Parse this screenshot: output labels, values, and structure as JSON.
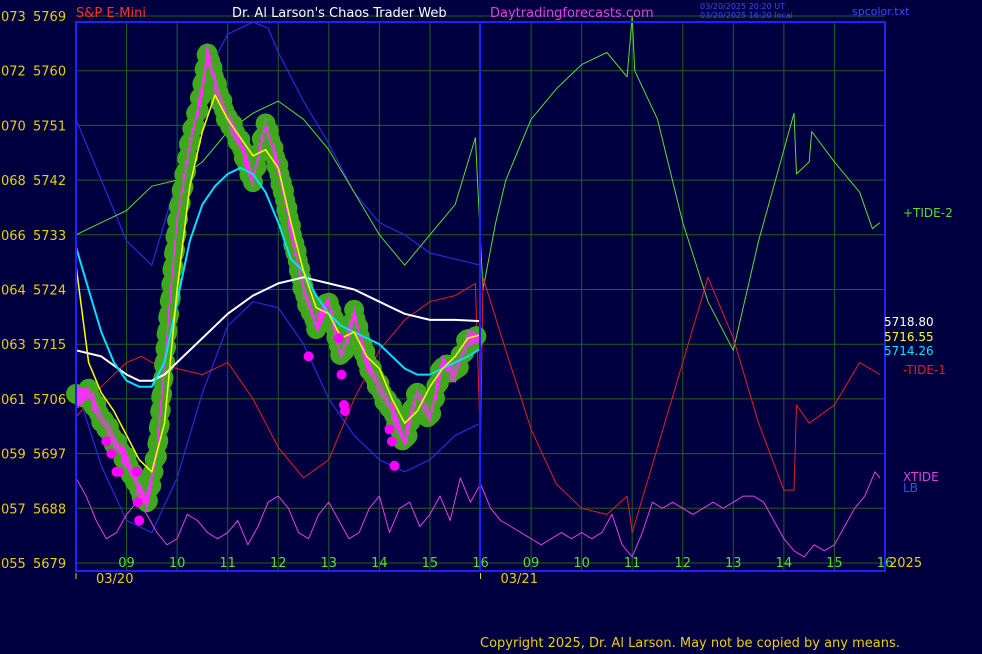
{
  "header": {
    "instrument": "S&P E-Mini",
    "site": "Dr. Al Larson's Chaos Trader Web",
    "url": "Daytradingforecasts.com",
    "stamp_line1": "03/20/2025 20:20 UT",
    "stamp_line2": "03/20/2025 16:20 local",
    "filename": "spcolor.txt"
  },
  "footer": {
    "copyright": "Copyright 2025, Dr. Al Larson. May not be copied by any means."
  },
  "colors": {
    "background": "#000040",
    "frame": "#2020ff",
    "grid": "#1f5f1f",
    "axis_text": "#e8d000",
    "price_bars": "#ff30ff",
    "price_halo": "#3fa81e",
    "ma_fast": "#ffff00",
    "ma_mid": "#00e0ff",
    "ma_slow": "#ffffff",
    "tide_plus": "#5fdc2a",
    "tide_minus": "#e02020",
    "xtide": "#e040e0",
    "envelope": "#2a2ad8",
    "marker": "#ff00ff"
  },
  "chart_data": {
    "type": "line",
    "title": "S&P E-Mini",
    "y_axis": {
      "label_pairs": [
        {
          "left": "073",
          "price": "5769"
        },
        {
          "left": "072",
          "price": "5760"
        },
        {
          "left": "070",
          "price": "5751"
        },
        {
          "left": "068",
          "price": "5742"
        },
        {
          "left": "066",
          "price": "5733"
        },
        {
          "left": "064",
          "price": "5724"
        },
        {
          "left": "063",
          "price": "5715"
        },
        {
          "left": "061",
          "price": "5706"
        },
        {
          "left": "059",
          "price": "5697"
        },
        {
          "left": "057",
          "price": "5688"
        },
        {
          "left": "055",
          "price": "5679"
        }
      ],
      "range": [
        5679,
        5769
      ]
    },
    "x_axis": {
      "hour_ticks": [
        "09",
        "10",
        "11",
        "12",
        "13",
        "14",
        "15",
        "16",
        "09",
        "10",
        "11",
        "12",
        "13",
        "14",
        "15",
        "16"
      ],
      "date_labels": [
        "03/20",
        "03/21"
      ],
      "year_label": "2025",
      "hour_range": [
        8,
        24
      ],
      "day_split_hour": 16
    },
    "readouts": {
      "ma_slow": "5718.80",
      "ma_fast": "5716.55",
      "ma_mid": "5714.26"
    },
    "series_labels": {
      "tide_plus": "+TIDE-2",
      "tide_minus": "-TIDE-1",
      "xtide": "XTIDE",
      "lb": "LB"
    },
    "price": {
      "t": [
        8.0,
        8.25,
        8.5,
        8.75,
        9.0,
        9.25,
        9.4,
        9.6,
        9.75,
        10.0,
        10.25,
        10.5,
        10.6,
        10.75,
        11.0,
        11.25,
        11.5,
        11.75,
        12.0,
        12.25,
        12.5,
        12.75,
        13.0,
        13.25,
        13.5,
        13.75,
        14.0,
        14.25,
        14.5,
        14.75,
        15.0,
        15.25,
        15.5,
        15.75,
        16.0
      ],
      "v": [
        5706,
        5707,
        5703,
        5699,
        5696,
        5691,
        5689,
        5697,
        5712,
        5735,
        5748,
        5757,
        5763,
        5758,
        5752,
        5748,
        5742,
        5751,
        5744,
        5734,
        5724,
        5718,
        5722,
        5713,
        5720,
        5712,
        5708,
        5704,
        5699,
        5707,
        5703,
        5712,
        5710,
        5716,
        5716
      ]
    },
    "ma_fast": {
      "t": [
        8.0,
        8.25,
        8.5,
        8.75,
        9.0,
        9.25,
        9.5,
        9.75,
        10.0,
        10.25,
        10.5,
        10.75,
        11.0,
        11.25,
        11.5,
        11.75,
        12.0,
        12.25,
        12.5,
        12.75,
        13.0,
        13.25,
        13.5,
        13.75,
        14.0,
        14.25,
        14.5,
        14.75,
        15.0,
        15.25,
        15.5,
        15.75,
        16.0
      ],
      "v": [
        5728,
        5712,
        5707,
        5704,
        5700,
        5696,
        5694,
        5702,
        5724,
        5741,
        5750,
        5756,
        5752,
        5749,
        5746,
        5747,
        5744,
        5735,
        5727,
        5721,
        5720,
        5716,
        5717,
        5713,
        5711,
        5706,
        5702,
        5704,
        5708,
        5711,
        5713,
        5716,
        5716.55
      ]
    },
    "ma_mid": {
      "t": [
        8.0,
        8.25,
        8.5,
        8.75,
        9.0,
        9.25,
        9.5,
        9.75,
        10.0,
        10.25,
        10.5,
        10.75,
        11.0,
        11.25,
        11.5,
        11.75,
        12.0,
        12.25,
        12.5,
        12.75,
        13.0,
        13.25,
        13.5,
        13.75,
        14.0,
        14.25,
        14.5,
        14.75,
        15.0,
        15.25,
        15.5,
        15.75,
        16.0
      ],
      "v": [
        5731,
        5724,
        5717,
        5712,
        5709,
        5708,
        5708,
        5712,
        5722,
        5732,
        5738,
        5741,
        5743,
        5744,
        5743,
        5740,
        5735,
        5729,
        5727,
        5723,
        5720,
        5718,
        5717,
        5716,
        5715,
        5713,
        5711,
        5710,
        5710,
        5711,
        5712,
        5713,
        5714.26
      ]
    },
    "ma_slow": {
      "t": [
        8.0,
        8.5,
        9.0,
        9.25,
        9.5,
        9.75,
        10.0,
        10.5,
        11.0,
        11.5,
        12.0,
        12.5,
        13.0,
        13.5,
        14.0,
        14.5,
        15.0,
        15.5,
        16.0
      ],
      "v": [
        5714,
        5713,
        5710,
        5709,
        5709,
        5710,
        5712,
        5716,
        5720,
        5723,
        5725,
        5726,
        5725,
        5724,
        5722,
        5720,
        5719,
        5719,
        5718.8
      ]
    },
    "tide_plus": {
      "t": [
        8.0,
        8.25,
        8.5,
        9.0,
        9.5,
        10.0,
        10.5,
        11.0,
        11.5,
        12.0,
        12.5,
        13.0,
        13.5,
        14.0,
        14.5,
        15.0,
        15.5,
        15.9,
        16.0,
        16.05,
        16.3,
        16.5,
        17.0,
        17.5,
        18.0,
        18.5,
        18.9,
        19.0,
        19.05,
        19.5,
        20.0,
        20.5,
        21.0,
        21.5,
        22.0,
        22.2,
        22.25,
        22.5,
        22.55,
        23.0,
        23.5,
        23.75,
        23.9
      ],
      "v": [
        5733,
        5734,
        5735,
        5737,
        5741,
        5742,
        5745,
        5750,
        5753,
        5755,
        5752,
        5747,
        5740,
        5733,
        5728,
        5733,
        5738,
        5749,
        5732,
        5724,
        5735,
        5742,
        5752,
        5757,
        5761,
        5763,
        5759,
        5769,
        5760,
        5752,
        5735,
        5722,
        5714,
        5732,
        5747,
        5753,
        5743,
        5745,
        5750,
        5745,
        5740,
        5734,
        5735
      ]
    },
    "tide_minus": {
      "t": [
        8.0,
        8.5,
        9.0,
        9.3,
        9.5,
        10.0,
        10.5,
        11.0,
        11.5,
        12.0,
        12.5,
        13.0,
        13.5,
        14.0,
        14.5,
        15.0,
        15.5,
        15.9,
        16.0,
        16.05,
        16.5,
        17.0,
        17.5,
        18.0,
        18.5,
        18.9,
        19.0,
        19.5,
        20.0,
        20.5,
        21.0,
        21.5,
        22.0,
        22.2,
        22.25,
        22.5,
        23.0,
        23.5,
        23.9
      ],
      "v": [
        5703,
        5708,
        5712,
        5713,
        5712,
        5711,
        5710,
        5712,
        5706,
        5698,
        5693,
        5696,
        5706,
        5714,
        5719,
        5722,
        5723,
        5725,
        5698,
        5726,
        5714,
        5701,
        5692,
        5688,
        5687,
        5690,
        5684,
        5698,
        5712,
        5726,
        5716,
        5702,
        5691,
        5691,
        5705,
        5702,
        5705,
        5712,
        5710
      ]
    },
    "xtide": {
      "t": [
        8.0,
        8.2,
        8.4,
        8.6,
        8.8,
        9.0,
        9.2,
        9.4,
        9.6,
        9.8,
        10.0,
        10.2,
        10.4,
        10.6,
        10.8,
        11.0,
        11.2,
        11.4,
        11.6,
        11.8,
        12.0,
        12.2,
        12.4,
        12.6,
        12.8,
        13.0,
        13.2,
        13.4,
        13.6,
        13.8,
        14.0,
        14.2,
        14.4,
        14.6,
        14.8,
        15.0,
        15.2,
        15.4,
        15.6,
        15.8,
        16.0,
        16.2,
        16.4,
        16.6,
        16.8,
        17.0,
        17.2,
        17.4,
        17.6,
        17.8,
        18.0,
        18.2,
        18.4,
        18.6,
        18.8,
        19.0,
        19.2,
        19.4,
        19.6,
        19.8,
        20.0,
        20.2,
        20.4,
        20.6,
        20.8,
        21.0,
        21.2,
        21.4,
        21.6,
        21.8,
        22.0,
        22.2,
        22.4,
        22.6,
        22.8,
        23.0,
        23.2,
        23.4,
        23.6,
        23.8,
        23.9
      ],
      "v": [
        5693,
        5690,
        5686,
        5683,
        5684,
        5687,
        5689,
        5687,
        5684,
        5682,
        5683,
        5687,
        5686,
        5684,
        5683,
        5684,
        5686,
        5682,
        5685,
        5689,
        5690,
        5688,
        5684,
        5683,
        5687,
        5689,
        5686,
        5683,
        5684,
        5688,
        5690,
        5684,
        5688,
        5689,
        5685,
        5687,
        5690,
        5686,
        5693,
        5689,
        5692,
        5688,
        5686,
        5685,
        5684,
        5683,
        5682,
        5683,
        5684,
        5683,
        5684,
        5683,
        5684,
        5687,
        5682,
        5680,
        5684,
        5689,
        5688,
        5689,
        5688,
        5687,
        5688,
        5689,
        5688,
        5689,
        5690,
        5690,
        5689,
        5686,
        5683,
        5681,
        5680,
        5682,
        5681,
        5682,
        5685,
        5688,
        5690,
        5694,
        5693
      ]
    },
    "envelope_upper": {
      "t": [
        8.0,
        8.5,
        9.0,
        9.5,
        10.0,
        10.5,
        11.0,
        11.5,
        11.8,
        12.0,
        12.5,
        13.0,
        13.5,
        14.0,
        14.5,
        15.0,
        15.5,
        16.0
      ],
      "v": [
        5752,
        5742,
        5732,
        5728,
        5742,
        5758,
        5766,
        5768,
        5767,
        5763,
        5755,
        5748,
        5740,
        5735,
        5733,
        5730,
        5729,
        5728
      ]
    },
    "envelope_lower": {
      "t": [
        8.0,
        8.5,
        9.0,
        9.5,
        10.0,
        10.5,
        11.0,
        11.5,
        12.0,
        12.5,
        13.0,
        13.5,
        14.0,
        14.5,
        15.0,
        15.5,
        16.0
      ],
      "v": [
        5708,
        5695,
        5686,
        5684,
        5693,
        5707,
        5718,
        5722,
        5721,
        5715,
        5706,
        5700,
        5696,
        5694,
        5696,
        5700,
        5702
      ]
    },
    "markers": {
      "t": [
        8.6,
        8.7,
        8.8,
        8.85,
        9.2,
        9.22,
        9.25,
        12.6,
        13.2,
        13.25,
        13.3,
        13.32,
        14.2,
        14.25,
        14.3
      ],
      "v": [
        5699,
        5697,
        5694,
        5694,
        5694,
        5689,
        5686,
        5713,
        5716,
        5710,
        5705,
        5704,
        5701,
        5699,
        5695
      ]
    }
  }
}
